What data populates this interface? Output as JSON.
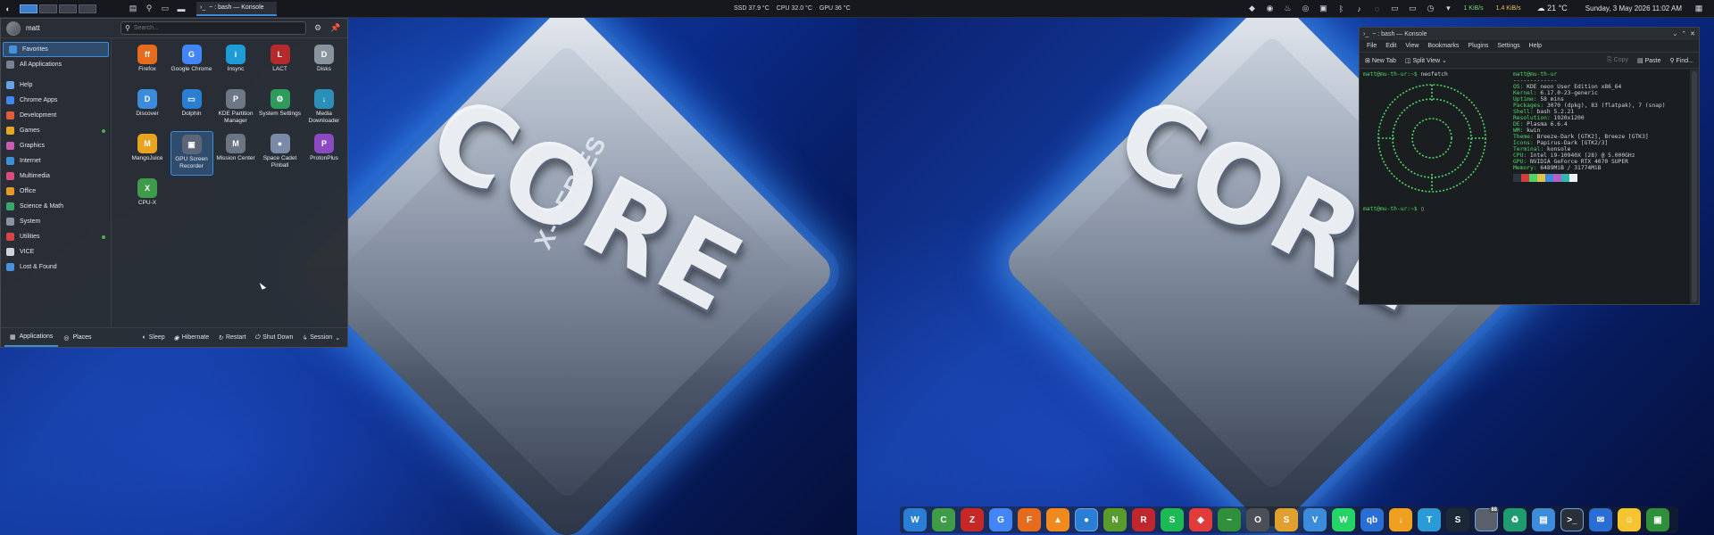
{
  "left_panel": {
    "task_title": "~ : bash — Konsole",
    "sensors": [
      "SSD 37.9 °C",
      "CPU 32.0 °C",
      "GPU 36 °C"
    ]
  },
  "right_panel": {
    "net_down": "1 KiB/s",
    "net_up": "1.4 KiB/s",
    "weather": "21 °C",
    "clock": "Sunday, 3 May 2026 11:02 AM"
  },
  "launcher": {
    "username": "matt",
    "search_placeholder": "Search...",
    "categories": [
      {
        "label": "Favorites",
        "color": "#4a90d9"
      },
      {
        "label": "All Applications",
        "color": "#7a8391"
      },
      {
        "label": "Help",
        "color": "#6aa3e4"
      },
      {
        "label": "Chrome Apps",
        "color": "#4285f4"
      },
      {
        "label": "Development",
        "color": "#e35d3a"
      },
      {
        "label": "Games",
        "color": "#e5a823"
      },
      {
        "label": "Graphics",
        "color": "#c95bb3"
      },
      {
        "label": "Internet",
        "color": "#3e8ed8"
      },
      {
        "label": "Multimedia",
        "color": "#d94b7b"
      },
      {
        "label": "Office",
        "color": "#e39a2b"
      },
      {
        "label": "Science & Math",
        "color": "#38a86a"
      },
      {
        "label": "System",
        "color": "#8a93a0"
      },
      {
        "label": "Utilities",
        "color": "#d94545"
      },
      {
        "label": "VICE",
        "color": "#cfd4db"
      },
      {
        "label": "Lost & Found",
        "color": "#4a90d9"
      }
    ],
    "apps": [
      {
        "label": "Firefox",
        "color": "#e56b1f",
        "glyph": "ff"
      },
      {
        "label": "Google Chrome",
        "color": "#4285f4",
        "glyph": "G"
      },
      {
        "label": "Insync",
        "color": "#1f9bd8",
        "glyph": "i"
      },
      {
        "label": "LACT",
        "color": "#b52a2a",
        "glyph": "L"
      },
      {
        "label": "Disks",
        "color": "#8a93a0",
        "glyph": "D"
      },
      {
        "label": "Discover",
        "color": "#3d8bdb",
        "glyph": "D"
      },
      {
        "label": "Dolphin",
        "color": "#2a7fd4",
        "glyph": "▭"
      },
      {
        "label": "KDE Partition Manager",
        "color": "#6d7785",
        "glyph": "P"
      },
      {
        "label": "System Settings",
        "color": "#2e9b5d",
        "glyph": "⚙"
      },
      {
        "label": "Media Downloader",
        "color": "#2b8fb8",
        "glyph": "↓"
      },
      {
        "label": "MangoJuice",
        "color": "#e8a41f",
        "glyph": "M"
      },
      {
        "label": "GPU Screen Recorder",
        "color": "#5b6676",
        "glyph": "▣"
      },
      {
        "label": "Mission Center",
        "color": "#6b7583",
        "glyph": "M"
      },
      {
        "label": "Space Cadet Pinball",
        "color": "#7a8aa8",
        "glyph": "●"
      },
      {
        "label": "ProtonPlus",
        "color": "#8b4ac2",
        "glyph": "P"
      },
      {
        "label": "CPU-X",
        "color": "#3d9b4a",
        "glyph": "X"
      }
    ],
    "footer": {
      "applications": "Applications",
      "places": "Places",
      "sleep": "Sleep",
      "hibernate": "Hibernate",
      "restart": "Restart",
      "shutdown": "Shut Down",
      "session": "Session"
    }
  },
  "konsole": {
    "title": "~ : bash — Konsole",
    "menu": [
      "File",
      "Edit",
      "View",
      "Bookmarks",
      "Plugins",
      "Settings",
      "Help"
    ],
    "toolbar": {
      "new_tab": "New Tab",
      "split_view": "Split View",
      "copy": "Copy",
      "paste": "Paste",
      "find": "Find..."
    },
    "prompt": "matt@mu-th-ur:~$",
    "command": "neofetch",
    "neofetch": {
      "header": "matt@mu-th-ur",
      "separator": "-------------",
      "lines": [
        {
          "key": "OS:",
          "val": " KDE neon User Edition x86_64"
        },
        {
          "key": "Kernel:",
          "val": " 6.17.0-23-generic"
        },
        {
          "key": "Uptime:",
          "val": " 58 mins"
        },
        {
          "key": "Packages:",
          "val": " 3070 (dpkg), 83 (flatpak), 7 (snap)"
        },
        {
          "key": "Shell:",
          "val": " bash 5.2.21"
        },
        {
          "key": "Resolution:",
          "val": " 1920x1200"
        },
        {
          "key": "DE:",
          "val": " Plasma 6.6.4"
        },
        {
          "key": "WM:",
          "val": " kwin"
        },
        {
          "key": "Theme:",
          "val": " Breeze-Dark [GTK2], Breeze [GTK3]"
        },
        {
          "key": "Icons:",
          "val": " Papirus-Dark [GTK2/3]"
        },
        {
          "key": "Terminal:",
          "val": " konsole"
        },
        {
          "key": "CPU:",
          "val": " Intel i9-10940X (28) @ 5.000GHz"
        },
        {
          "key": "GPU:",
          "val": " NVIDIA GeForce RTX 4070 SUPER"
        },
        {
          "key": "Memory:",
          "val": " 6489MiB / 31774MiB"
        }
      ],
      "palette": [
        "#2e3440",
        "#d33c3c",
        "#4fd46a",
        "#e5c04a",
        "#3d8bdb",
        "#b85fc4",
        "#2fb8b0",
        "#eceff4"
      ]
    }
  },
  "wallpaper": {
    "big_text": "CORE",
    "small_text": "X-SERIES"
  },
  "dock": [
    {
      "name": "writer",
      "color": "#2a7fd4",
      "glyph": "W"
    },
    {
      "name": "calc",
      "color": "#3d9b4a",
      "glyph": "C"
    },
    {
      "name": "filezilla",
      "color": "#c62828",
      "glyph": "Z"
    },
    {
      "name": "chrome",
      "color": "#4285f4",
      "glyph": "G"
    },
    {
      "name": "firefox",
      "color": "#e56b1f",
      "glyph": "F"
    },
    {
      "name": "vlc",
      "color": "#f08a1f",
      "glyph": "▲"
    },
    {
      "name": "browser",
      "color": "#2a7fd4",
      "glyph": "●",
      "active": true
    },
    {
      "name": "nvidia",
      "color": "#5a9b2e",
      "glyph": "N"
    },
    {
      "name": "raspberry",
      "color": "#c0262d",
      "glyph": "R"
    },
    {
      "name": "spotify",
      "color": "#1db954",
      "glyph": "S"
    },
    {
      "name": "anydesk",
      "color": "#e23b3b",
      "glyph": "◆"
    },
    {
      "name": "monitor",
      "color": "#2f8f3a",
      "glyph": "~"
    },
    {
      "name": "obs",
      "color": "#4a4f58",
      "glyph": "O"
    },
    {
      "name": "store",
      "color": "#e0a030",
      "glyph": "S"
    },
    {
      "name": "vpn",
      "color": "#3d8bdb",
      "glyph": "V"
    },
    {
      "name": "whatsapp",
      "color": "#25d366",
      "glyph": "W"
    },
    {
      "name": "qbittorrent",
      "color": "#2a6ed4",
      "glyph": "qb"
    },
    {
      "name": "downloader",
      "color": "#f0a020",
      "glyph": "↓"
    },
    {
      "name": "telegram",
      "color": "#2a9bd8",
      "glyph": "T"
    },
    {
      "name": "steam",
      "color": "#1b2838",
      "glyph": "S"
    },
    {
      "name": "system-monitor",
      "color": "#5a5f6a",
      "glyph": "88",
      "badge": "88",
      "active": true
    },
    {
      "name": "recycle",
      "color": "#1e9c70",
      "glyph": "♻"
    },
    {
      "name": "cpu",
      "color": "#3d8bdb",
      "glyph": "▤"
    },
    {
      "name": "konsole",
      "color": "#2b3038",
      "glyph": ">_",
      "active": true
    },
    {
      "name": "thunderbird",
      "color": "#2a6ed4",
      "glyph": "✉"
    },
    {
      "name": "emoji",
      "color": "#f4c431",
      "glyph": "☺"
    },
    {
      "name": "gpu-recorder",
      "color": "#2f8f3a",
      "glyph": "▣"
    }
  ]
}
